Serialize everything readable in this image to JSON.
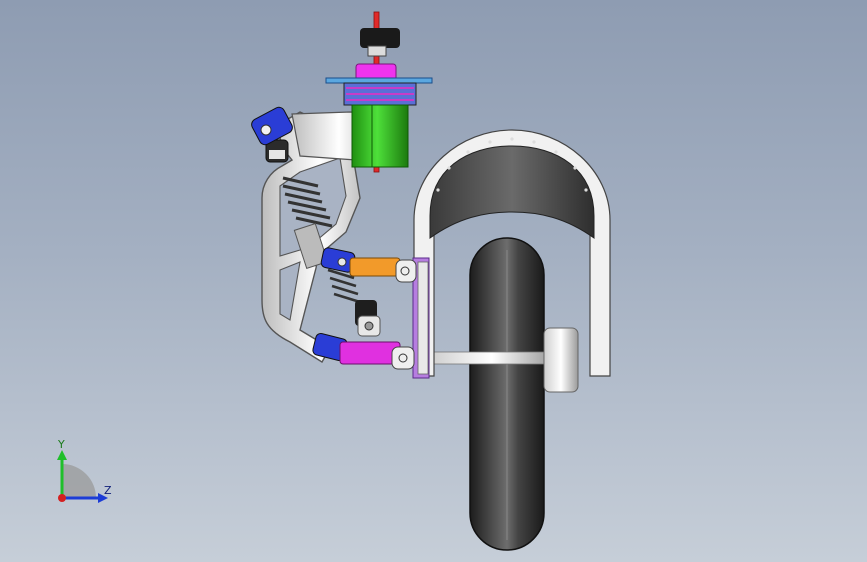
{
  "triad": {
    "y_label": "Y",
    "z_label": "Z",
    "colors": {
      "y": "#1fbf2a",
      "z": "#1c3cd6",
      "x": "#d42020"
    }
  },
  "colors": {
    "background_top": "#8e9cb2",
    "background_bottom": "#c6ced8",
    "frame": "#f2f2f2",
    "damper_body": "#33cc22",
    "motor_flange": "#ee33ee",
    "rod": "#e02a2a",
    "link_upper": "#f29a2a",
    "link_lower": "#e030e0",
    "mount_blue": "#2a3dd6",
    "plate": "#b67de0",
    "tire": "#2a2a2a"
  },
  "icons": [
    "coordinate-triad-icon"
  ]
}
